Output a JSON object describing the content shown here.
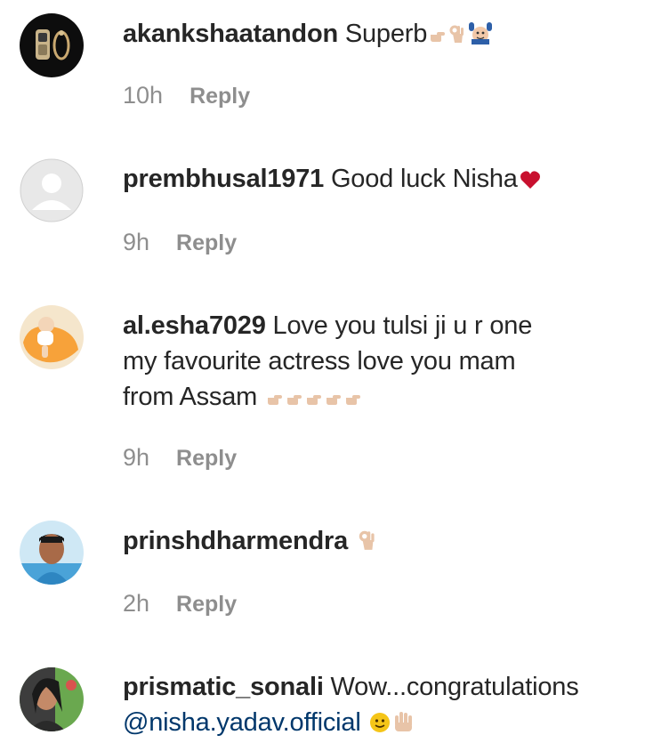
{
  "comments": [
    {
      "username": "akankshaatandon",
      "text": "Superb",
      "emojis": [
        "pointing-hand-icon",
        "ok-hand-icon",
        "raising-hands-face-icon"
      ],
      "time": "10h",
      "reply": "Reply"
    },
    {
      "username": "prembhusal1971",
      "text": "Good luck Nisha",
      "emojis": [
        "red-heart-icon"
      ],
      "time": "9h",
      "reply": "Reply"
    },
    {
      "username": "al.esha7029",
      "text_line1": "Love you tulsi ji u r one",
      "text_line2": "my favourite actress love you mam",
      "text_line3": "from Assam",
      "emojis": [
        "pointing-hand-icon",
        "pointing-hand-icon",
        "pointing-hand-icon",
        "pointing-hand-icon",
        "pointing-hand-icon"
      ],
      "time": "9h",
      "reply": "Reply"
    },
    {
      "username": "prinshdharmendra",
      "text": "",
      "emojis": [
        "ok-hand-icon"
      ],
      "time": "2h",
      "reply": "Reply"
    },
    {
      "username": "prismatic_sonali",
      "text": "Wow...congratulations",
      "mention": "@nisha.yadav.official",
      "emojis": [
        "smiley-face-icon",
        "waving-hand-icon"
      ]
    }
  ],
  "colors": {
    "text": "#262626",
    "meta": "#8e8e8e",
    "mention": "#00376b",
    "heart": "#c8102e",
    "skin": "#e8c4a8"
  }
}
